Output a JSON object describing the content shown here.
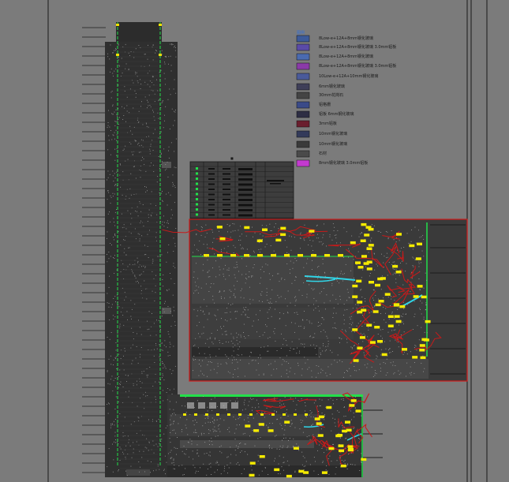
{
  "drawing": {
    "legend_title": "图例",
    "legend": [
      {
        "code": "l1",
        "label": "8Low-e+12A+8mm钢化玻璃",
        "swatch": "#3c5a9a"
      },
      {
        "code": "l2",
        "label": "8Low-e+12A+8mm钢化玻璃 3.0mm铝板",
        "swatch": "#5a4aa8"
      },
      {
        "code": "l3",
        "label": "8Low-e+12A+8mm钢化玻璃",
        "swatch": "#4a6ab0"
      },
      {
        "code": "l4",
        "label": "8Low-e+12A+8mm钢化玻璃 3.0mm铝板",
        "swatch": "#8a3aa8"
      },
      {
        "code": "l5",
        "label": "10Low-e+12A+10mm钢化玻璃",
        "swatch": "#4a5a9a"
      },
      {
        "code": "l6",
        "label": "6mm钢化玻璃",
        "swatch": "#3e3e58"
      },
      {
        "code": "l7",
        "label": "30mm花岗石",
        "swatch": "#444444"
      },
      {
        "code": "l8",
        "label": "铝格栅",
        "swatch": "#3a4a88"
      },
      {
        "code": "l9",
        "label": "铝板 6mm钢化玻璃",
        "swatch": "#2e2e44"
      },
      {
        "code": "l10",
        "label": "3mm铝板",
        "swatch": "#6a1e2e"
      },
      {
        "code": "l11",
        "label": "10mm钢化玻璃",
        "swatch": "#333a5a"
      },
      {
        "code": "l12",
        "label": "10mm钢化玻璃",
        "swatch": "#3a3a3a"
      },
      {
        "code": "l13",
        "label": "石材",
        "swatch": "#4a4a4a"
      },
      {
        "code": "l14",
        "label": "8mm钢化玻璃 3.0mm铝板",
        "swatch": "#c43ad0"
      }
    ],
    "table_title": "■"
  }
}
